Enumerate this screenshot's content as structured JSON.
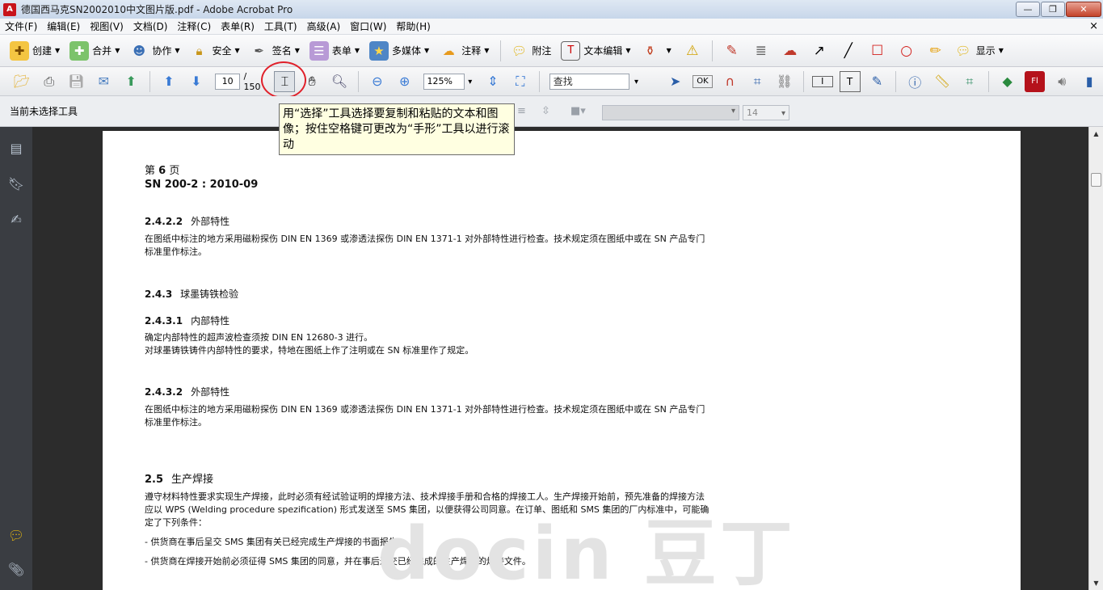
{
  "window": {
    "title": "德国西马克SN2002010中文图片版.pdf - Adobe Acrobat Pro",
    "minimize": "—",
    "restore": "❐",
    "close": "✕"
  },
  "menu": {
    "items": [
      "文件(F)",
      "编辑(E)",
      "视图(V)",
      "文档(D)",
      "注释(C)",
      "表单(R)",
      "工具(T)",
      "高级(A)",
      "窗口(W)",
      "帮助(H)"
    ],
    "close_x": "×"
  },
  "toolbar1": {
    "create": "创建",
    "combine": "合并",
    "collaborate": "协作",
    "secure": "安全",
    "sign": "签名",
    "forms": "表单",
    "multimedia": "多媒体",
    "comment": "注释",
    "sticky_note": "附注",
    "text_edit": "文本编辑",
    "show": "显示"
  },
  "toolbar2": {
    "page_current": "10",
    "page_total": "/ 150",
    "zoom": "125%",
    "find_placeholder": "查找"
  },
  "toolbar3": {
    "no_tool": "当前未选择工具",
    "font_size": "14"
  },
  "tooltip": {
    "text": "用“选择”工具选择要复制和粘贴的文本和图像；按住空格键可更改为“手形”工具以进行滚动"
  },
  "document": {
    "page_label_prefix": "第",
    "page_label_num": "6",
    "page_label_suffix": "页",
    "doc_number": "SN 200-2 : 2010-09",
    "s1_num": "2.4.2.2",
    "s1_title": "外部特性",
    "s1_text": "在图纸中标注的地方采用磁粉探伤 DIN EN 1369 或渗透法探伤 DIN EN 1371-1 对外部特性进行检查。技术规定须在图纸中或在 SN 产品专门标准里作标注。",
    "s2_num": "2.4.3",
    "s2_title": "球墨铸铁检验",
    "s3_num": "2.4.3.1",
    "s3_title": "内部特性",
    "s3_text1": "确定内部特性的超声波检查须按 DIN EN 12680-3 进行。",
    "s3_text2": "对球墨铸铁铸件内部特性的要求，特地在图纸上作了注明或在 SN 标准里作了规定。",
    "s4_num": "2.4.3.2",
    "s4_title": "外部特性",
    "s4_text": "在图纸中标注的地方采用磁粉探伤 DIN EN 1369 或渗透法探伤 DIN EN 1371-1 对外部特性进行检查。技术规定须在图纸中或在 SN 产品专门标准里作标注。",
    "s5_num": "2.5",
    "s5_title": "生产焊接",
    "s5_text": "遵守材料特性要求实现生产焊接，此时必须有经试验证明的焊接方法、技术焊接手册和合格的焊接工人。生产焊接开始前，预先准备的焊接方法应以 WPS (Welding procedure spezification) 形式发送至 SMS 集团，以便获得公司同意。在订单、图纸和 SMS 集团的厂内标准中，可能确定了下列条件：",
    "bullet1": "- 供货商在事后呈交 SMS 集团有关已经完成生产焊接的书面报告。",
    "bullet2": "- 供货商在焊接开始前必须征得 SMS 集团的同意，并在事后递交已经完成的生产焊接的焊接文件。",
    "watermark": "docin 豆丁"
  }
}
